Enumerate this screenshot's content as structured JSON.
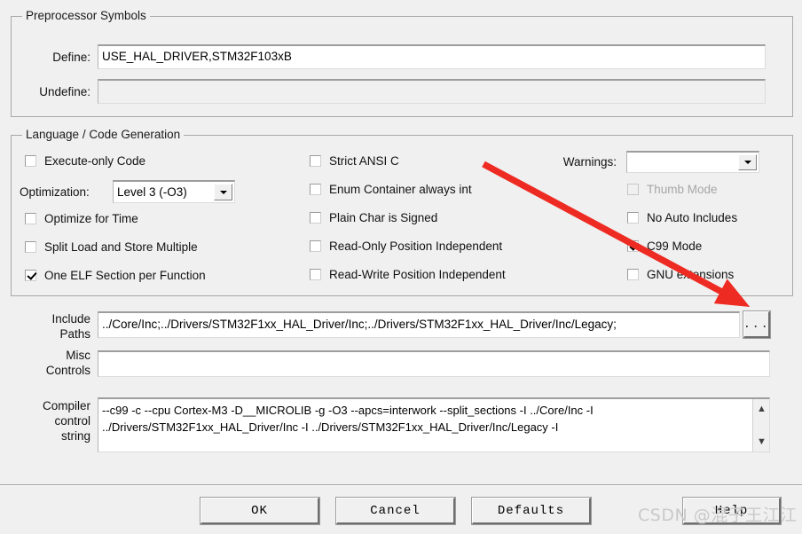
{
  "dialog": {
    "accent_red": "#ee2b23",
    "face_color": "#f0f0f0"
  },
  "preprocessor": {
    "legend": "Preprocessor Symbols",
    "define_label": "Define:",
    "define_value": "USE_HAL_DRIVER,STM32F103xB",
    "undefine_label": "Undefine:",
    "undefine_value": ""
  },
  "language": {
    "legend": "Language / Code Generation",
    "optimization_label": "Optimization:",
    "optimization_value": "Level 3 (-O3)",
    "warnings_label": "Warnings:",
    "warnings_value": "",
    "column_left": [
      {
        "label": "Execute-only Code",
        "checked": false,
        "disabled": false
      },
      {
        "label": "Optimize for Time",
        "checked": false,
        "disabled": false
      },
      {
        "label": "Split Load and Store Multiple",
        "checked": false,
        "disabled": false
      },
      {
        "label": "One ELF Section per Function",
        "checked": true,
        "disabled": false
      }
    ],
    "column_middle": [
      {
        "label": "Strict ANSI C",
        "checked": false,
        "disabled": false
      },
      {
        "label": "Enum Container always int",
        "checked": false,
        "disabled": false
      },
      {
        "label": "Plain Char is Signed",
        "checked": false,
        "disabled": false
      },
      {
        "label": "Read-Only Position Independent",
        "checked": false,
        "disabled": false
      },
      {
        "label": "Read-Write Position Independent",
        "checked": false,
        "disabled": false
      }
    ],
    "column_right": [
      {
        "label": "Thumb Mode",
        "checked": false,
        "disabled": true
      },
      {
        "label": "No Auto Includes",
        "checked": false,
        "disabled": false
      },
      {
        "label": "C99 Mode",
        "checked": true,
        "disabled": false
      },
      {
        "label": "GNU extensions",
        "checked": false,
        "disabled": false
      }
    ]
  },
  "paths": {
    "include_label_line1": "Include",
    "include_label_line2": "Paths",
    "include_value": "../Core/Inc;../Drivers/STM32F1xx_HAL_Driver/Inc;../Drivers/STM32F1xx_HAL_Driver/Inc/Legacy;",
    "browse_label": "...",
    "misc_label_line1": "Misc",
    "misc_label_line2": "Controls",
    "misc_value": ""
  },
  "compiler_control": {
    "label_line1": "Compiler",
    "label_line2": "control",
    "label_line3": "string",
    "line1": "--c99 -c --cpu Cortex-M3 -D__MICROLIB -g -O3 --apcs=interwork --split_sections -I ../Core/Inc -I",
    "line2": "../Drivers/STM32F1xx_HAL_Driver/Inc -I ../Drivers/STM32F1xx_HAL_Driver/Inc/Legacy -I",
    "scroll_up_icon": "chevron-up-icon",
    "scroll_down_icon": "chevron-down-icon"
  },
  "buttons": {
    "ok": "OK",
    "cancel": "Cancel",
    "defaults": "Defaults",
    "help": "Help"
  },
  "watermark": {
    "text": "CSDN @混子王江江"
  }
}
